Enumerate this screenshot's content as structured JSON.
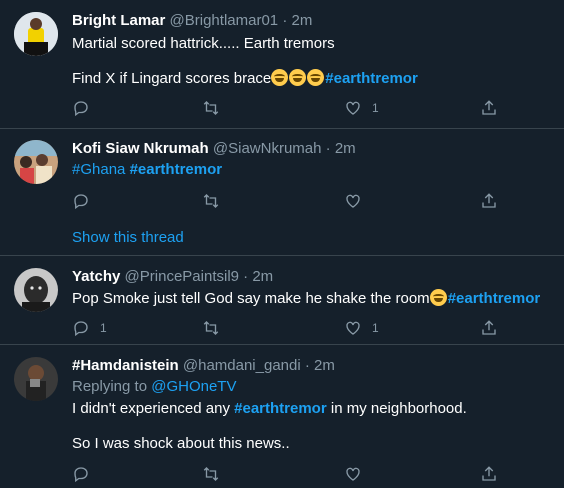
{
  "tweets": [
    {
      "name": "Bright Lamar",
      "handle": "@Brightlamar01",
      "time": "2m",
      "line1": "Martial scored hattrick..... Earth tremors",
      "line2_text": "Find X if Lingard scores brace",
      "line2_tag": "#earthtremor",
      "counts": {
        "reply": "",
        "retweet": "",
        "like": "1"
      }
    },
    {
      "name": "Kofi Siaw Nkrumah",
      "handle": "@SiawNkrumah",
      "time": "2m",
      "tag1": "#Ghana",
      "tag2": "#earthtremor",
      "counts": {
        "reply": "",
        "retweet": "",
        "like": ""
      },
      "show_thread": "Show this thread"
    },
    {
      "name": "Yatchy",
      "handle": "@PrincePaintsil9",
      "time": "2m",
      "line1_text": "Pop Smoke just tell God say make he shake the room",
      "line1_tag": "#earthtremor",
      "counts": {
        "reply": "1",
        "retweet": "",
        "like": "1"
      }
    },
    {
      "name": "#Hamdanistein",
      "handle": "@hamdani_gandi",
      "time": "2m",
      "reply_prefix": "Replying to",
      "reply_to": "@GHOneTV",
      "line1_a": "I didn't experienced any",
      "line1_tag": "#earthtremor",
      "line1_b": "in my neighborhood.",
      "line2": "So I was shock about this news..",
      "counts": {
        "reply": "",
        "retweet": "",
        "like": ""
      }
    }
  ],
  "separator": "·",
  "colors": {
    "background": "#15202b",
    "accent": "#1da1f2",
    "muted": "#8899a6",
    "divider": "#38444d"
  },
  "icons": {
    "reply": "reply-icon",
    "retweet": "retweet-icon",
    "like": "heart-icon",
    "share": "share-icon"
  }
}
